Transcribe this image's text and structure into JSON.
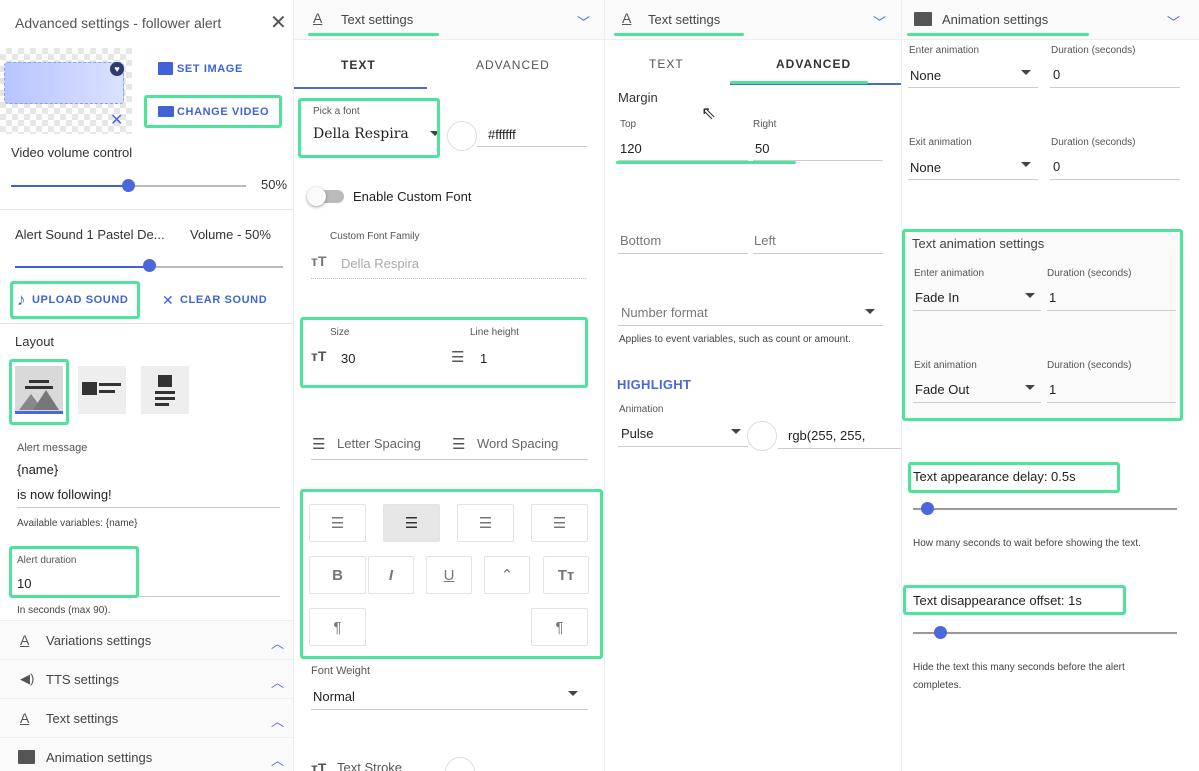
{
  "p1": {
    "title": "Advanced settings - follower alert",
    "set_image": "SET IMAGE",
    "change_video": "CHANGE VIDEO",
    "volume_label": "Video volume control",
    "volume_value": "50%",
    "video_volume_fraction": 0.5,
    "sound_name": "Alert Sound 1 Pastel De...",
    "sound_volume": "Volume - 50%",
    "sound_volume_fraction": 0.5,
    "upload_sound": "UPLOAD SOUND",
    "clear_sound": "CLEAR SOUND",
    "layout_label": "Layout",
    "alert_message_label": "Alert message",
    "alert_message_line1": "{name}",
    "alert_message_line2": "is now following!",
    "available_vars": "Available variables: {name}",
    "alert_duration_label": "Alert duration",
    "alert_duration_value": "10",
    "duration_help": "In seconds (max 90).",
    "sections": [
      {
        "label": "Variations settings",
        "icon": "text-format-icon"
      },
      {
        "label": "TTS settings",
        "icon": "speaker-icon"
      },
      {
        "label": "Text settings",
        "icon": "text-format-icon"
      },
      {
        "label": "Animation settings",
        "icon": "animation-icon"
      }
    ]
  },
  "p2": {
    "header": "Text settings",
    "tab_text": "TEXT",
    "tab_advanced": "ADVANCED",
    "font_label": "Pick a font",
    "font_value": "Della Respira",
    "color_value": "#ffffff",
    "custom_font_toggle": "Enable Custom Font",
    "custom_font_label": "Custom Font Family",
    "custom_font_placeholder": "Della Respira",
    "size_label": "Size",
    "size_value": "30",
    "line_height_label": "Line height",
    "line_height_value": "1",
    "letter_spacing": "Letter Spacing",
    "word_spacing": "Word Spacing",
    "font_weight_label": "Font Weight",
    "font_weight_value": "Normal",
    "text_stroke": "Text Stroke"
  },
  "p3": {
    "header": "Text settings",
    "tab_text": "TEXT",
    "tab_advanced": "ADVANCED",
    "margin_label": "Margin",
    "top_label": "Top",
    "top_value": "120",
    "right_label": "Right",
    "right_value": "50",
    "bottom_placeholder": "Bottom",
    "left_placeholder": "Left",
    "number_format_placeholder": "Number format",
    "number_format_help": "Applies to event variables, such as count or amount.",
    "highlight_title": "HIGHLIGHT",
    "animation_label": "Animation",
    "animation_value": "Pulse",
    "color_value": "rgb(255, 255,"
  },
  "p4": {
    "header": "Animation settings",
    "enter_label": "Enter animation",
    "enter_value": "None",
    "enter_dur_label": "Duration (seconds)",
    "enter_dur_value": "0",
    "exit_label": "Exit animation",
    "exit_value": "None",
    "exit_dur_label": "Duration (seconds)",
    "exit_dur_value": "0",
    "text_anim_title": "Text animation settings",
    "t_enter_label": "Enter animation",
    "t_enter_value": "Fade In",
    "t_enter_dur_label": "Duration (seconds)",
    "t_enter_dur_value": "1",
    "t_exit_label": "Exit animation",
    "t_exit_value": "Fade Out",
    "t_exit_dur_label": "Duration (seconds)",
    "t_exit_dur_value": "1",
    "appearance_delay": "Text appearance delay: 0.5s",
    "appearance_delay_fraction": 0.05,
    "appearance_help": "How many seconds to wait before showing the text.",
    "disappearance_offset": "Text disappearance offset: 1s",
    "disappearance_offset_fraction": 0.1,
    "disappearance_help1": "Hide the text this many seconds before the alert",
    "disappearance_help2": "completes."
  },
  "colors": {
    "accent": "#4060d8",
    "highlight": "#4de39a"
  }
}
